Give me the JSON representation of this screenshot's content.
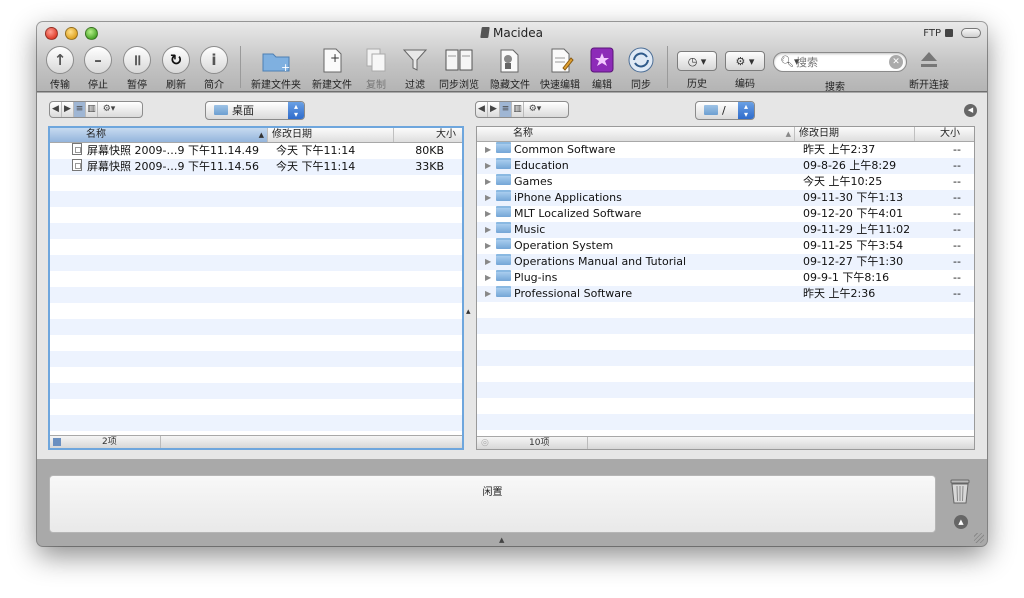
{
  "window": {
    "title": "Macidea",
    "ftp_label": "FTP"
  },
  "toolbar": {
    "transfer": "传输",
    "stop": "停止",
    "pause": "暂停",
    "refresh": "刷新",
    "info": "简介",
    "new_folder": "新建文件夹",
    "new_file": "新建文件",
    "copy": "复制",
    "filter": "过滤",
    "sync_browse": "同步浏览",
    "hide_files": "隐藏文件",
    "quick_edit": "快速编辑",
    "edit": "编辑",
    "sync": "同步",
    "history": "历史",
    "encoding": "编码",
    "search_placeholder": "搜索",
    "search_label": "搜索",
    "disconnect": "断开连接"
  },
  "left_pane": {
    "path": "桌面",
    "headers": {
      "name": "名称",
      "date": "修改日期",
      "size": "大小"
    },
    "files": [
      {
        "name": "屏幕快照 2009-…9 下午11.14.49",
        "date": "今天 下午11:14",
        "size": "80KB"
      },
      {
        "name": "屏幕快照 2009-…9 下午11.14.56",
        "date": "今天 下午11:14",
        "size": "33KB"
      }
    ],
    "count": "2项"
  },
  "right_pane": {
    "path": "/",
    "headers": {
      "name": "名称",
      "date": "修改日期",
      "size": "大小"
    },
    "files": [
      {
        "name": "Common Software",
        "date": "昨天 上午2:37",
        "size": "--"
      },
      {
        "name": "Education",
        "date": "09-8-26 上午8:29",
        "size": "--"
      },
      {
        "name": "Games",
        "date": "今天 上午10:25",
        "size": "--"
      },
      {
        "name": "iPhone Applications",
        "date": "09-11-30 下午1:13",
        "size": "--"
      },
      {
        "name": "MLT Localized Software",
        "date": "09-12-20 下午4:01",
        "size": "--"
      },
      {
        "name": "Music",
        "date": "09-11-29 上午11:02",
        "size": "--"
      },
      {
        "name": "Operation System",
        "date": "09-11-25 下午3:54",
        "size": "--"
      },
      {
        "name": "Operations Manual and Tutorial",
        "date": "09-12-27 下午1:30",
        "size": "--"
      },
      {
        "name": "Plug-ins",
        "date": "09-9-1 下午8:16",
        "size": "--"
      },
      {
        "name": "Professional Software",
        "date": "昨天 上午2:36",
        "size": "--"
      }
    ],
    "count": "10项"
  },
  "transfer_panel": {
    "status": "闲置"
  },
  "icons": {
    "transfer": "up-arrow-icon",
    "stop": "stop-icon",
    "pause": "pause-icon",
    "refresh": "refresh-icon",
    "info": "info-icon",
    "trash": "trash-icon"
  }
}
